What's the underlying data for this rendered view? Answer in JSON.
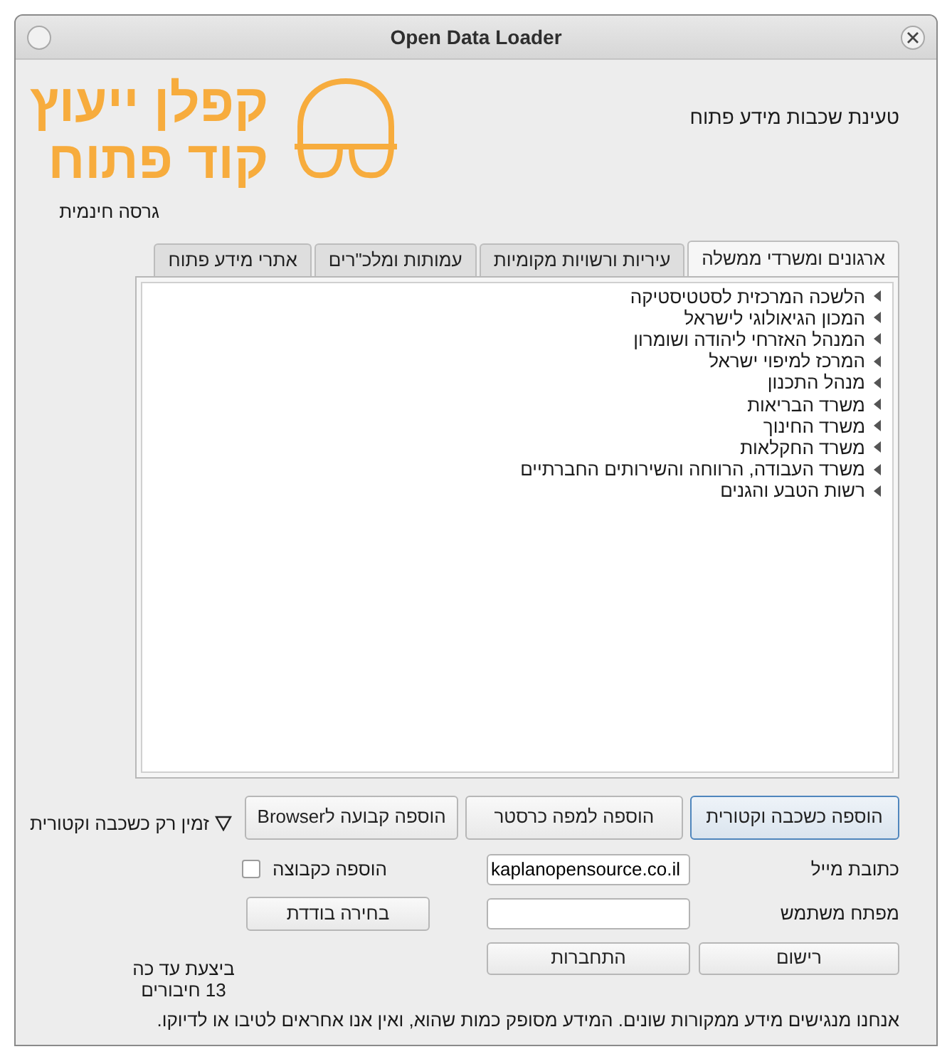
{
  "window": {
    "title": "Open Data Loader"
  },
  "logo": {
    "lines": [
      "קפלן ייעוץ",
      "קוד פתוח"
    ]
  },
  "header": {
    "title": "טעינת שכבות מידע פתוח",
    "edition": "גרסה חינמית"
  },
  "tabs": [
    {
      "label": "ארגונים ומשרדי ממשלה",
      "selected": true
    },
    {
      "label": "עיריות ורשויות מקומיות",
      "selected": false
    },
    {
      "label": "עמותות ומלכ\"רים",
      "selected": false
    },
    {
      "label": "אתרי מידע פתוח",
      "selected": false
    }
  ],
  "tree": {
    "items": [
      {
        "label": "הלשכה המרכזית לסטטיסטיקה",
        "expanded": false
      },
      {
        "label": "המכון הגיאולוגי לישראל",
        "expanded": false
      },
      {
        "label": "המנהל האזרחי ליהודה ושומרון",
        "expanded": false
      },
      {
        "label": "המרכז למיפוי ישראל",
        "expanded": false
      },
      {
        "label": "מנהל התכנון",
        "expanded": false
      },
      {
        "label": "משרד הבריאות",
        "expanded": false
      },
      {
        "label": "משרד החינוך",
        "expanded": false
      },
      {
        "label": "משרד החקלאות",
        "expanded": false
      },
      {
        "label": "משרד העבודה, הרווחה והשירותים החברתיים",
        "expanded": false
      },
      {
        "label": "רשות הטבע והגנים",
        "expanded": false
      }
    ]
  },
  "add_buttons": [
    {
      "label": "הוספה כשכבה וקטורית",
      "selected": true
    },
    {
      "label": "הוספה למפה כרסטר",
      "selected": false
    },
    {
      "label": "הוספה קבועה לBrowser",
      "selected": false
    }
  ],
  "availability": {
    "label": "זמין רק כשכבה וקטורית"
  },
  "email": {
    "label": "כתובת מייל",
    "value": "kaplanopensource.co.il"
  },
  "group_checkbox": {
    "label": "הוספה כקבוצה",
    "checked": false
  },
  "user_key": {
    "label": "מפתח משתמש"
  },
  "single_select_button": {
    "label": "בחירה בודדת"
  },
  "register_button": {
    "label": "רישום"
  },
  "connect_button": {
    "label": "התחברות"
  },
  "counter": {
    "lines": [
      "ביצעת עד כה",
      "13 חיבורים"
    ]
  },
  "disclaimer": "אנחנו מנגישים מידע ממקורות שונים. המידע מסופק כמות שהוא, ואין אנו אחראים לטיבו או לדיוקו."
}
